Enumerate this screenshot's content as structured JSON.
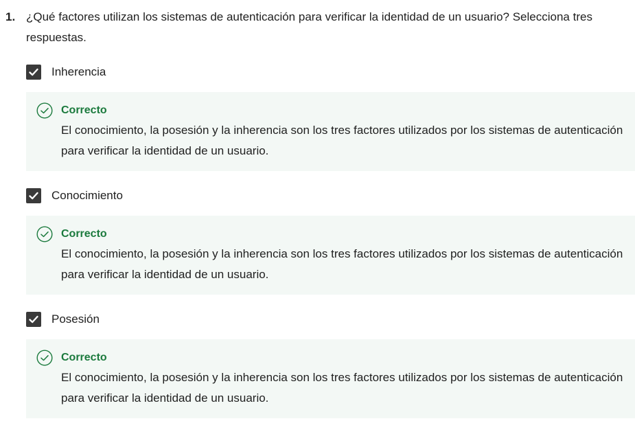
{
  "question": {
    "number": "1.",
    "text": "¿Qué factores utilizan los sistemas de autenticación para verificar la identidad de un usuario? Selecciona tres respuestas."
  },
  "options": [
    {
      "label": "Inherencia",
      "checked": true,
      "feedback": {
        "icon": "check-circle-icon",
        "title": "Correcto",
        "text": "El conocimiento, la posesión y la inherencia son los tres factores utilizados por los sistemas de autenticación para verificar la identidad de un usuario."
      }
    },
    {
      "label": "Conocimiento",
      "checked": true,
      "feedback": {
        "icon": "check-circle-icon",
        "title": "Correcto",
        "text": "El conocimiento, la posesión y la inherencia son los tres factores utilizados por los sistemas de autenticación para verificar la identidad de un usuario."
      }
    },
    {
      "label": "Posesión",
      "checked": true,
      "feedback": {
        "icon": "check-circle-icon",
        "title": "Correcto",
        "text": "El conocimiento, la posesión y la inherencia son los tres factores utilizados por los sistemas de autenticación para verificar la identidad de un usuario."
      }
    }
  ],
  "colors": {
    "correct_green": "#1b7a3d",
    "feedback_background": "#f3f8f5",
    "checkbox_fill": "#3a3a3a"
  }
}
